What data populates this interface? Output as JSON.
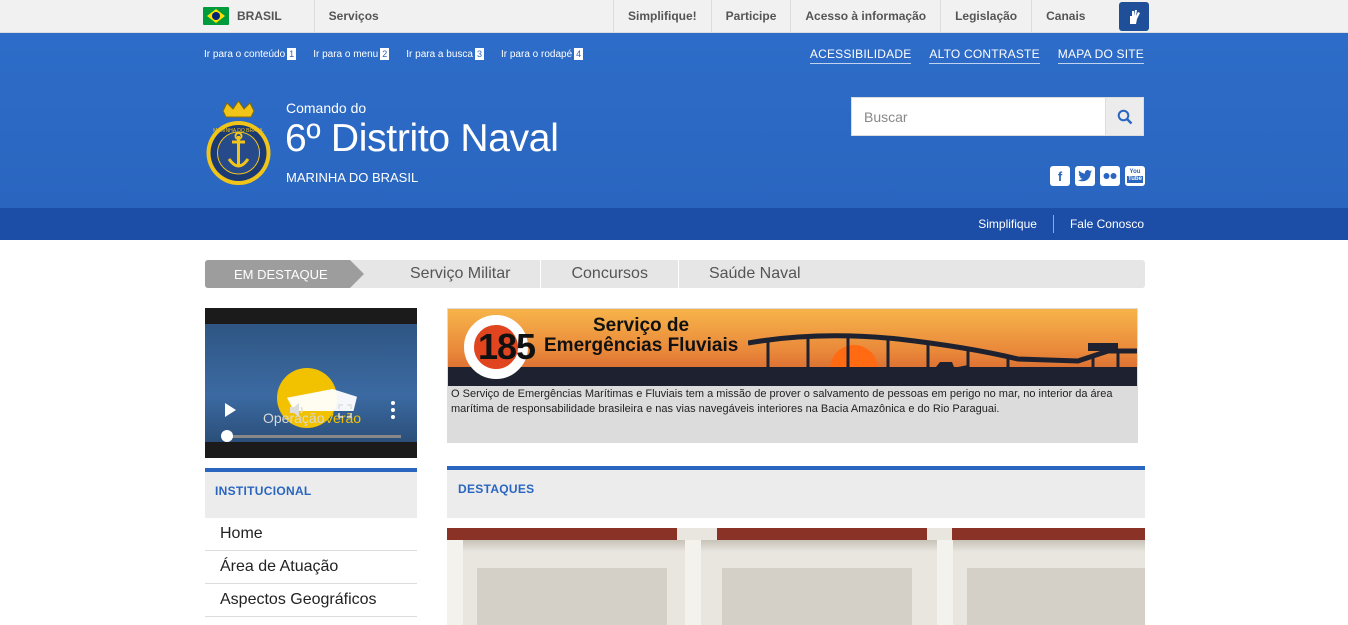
{
  "govbar": {
    "country": "BRASIL",
    "services": "Serviços",
    "links": [
      "Simplifique!",
      "Participe",
      "Acesso à informação",
      "Legislação",
      "Canais"
    ]
  },
  "header": {
    "skip_links": [
      {
        "label": "Ir para o conteúdo",
        "key": "1"
      },
      {
        "label": "Ir para o menu",
        "key": "2"
      },
      {
        "label": "Ir para a busca",
        "key": "3"
      },
      {
        "label": "Ir para o rodapé",
        "key": "4"
      }
    ],
    "top_links": [
      "ACESSIBILIDADE",
      "ALTO CONTRASTE",
      "MAPA DO SITE"
    ],
    "brand_sub": "Comando do",
    "brand_title": "6º Distrito Naval",
    "brand_org": "MARINHA DO BRASIL",
    "logo_text": "MARINHA DO BRASIL",
    "search_placeholder": "Buscar",
    "socials": [
      "facebook-icon",
      "twitter-icon",
      "flickr-icon",
      "youtube-icon"
    ]
  },
  "subbar": {
    "links": [
      "Simplifique",
      "Fale Conosco"
    ]
  },
  "tabs": {
    "active": "EM DESTAQUE",
    "items": [
      "Serviço Militar",
      "Concursos",
      "Saúde Naval"
    ]
  },
  "video": {
    "title_a": "Operação",
    "title_b": "Verão"
  },
  "sidebar": {
    "heading": "INSTITUCIONAL",
    "items": [
      "Home",
      "Área de Atuação",
      "Aspectos Geográficos"
    ]
  },
  "banner": {
    "number": "185",
    "line1": "Serviço de",
    "line2": "Emergências Fluviais",
    "description": "O Serviço de Emergências Marítimas e Fluviais tem a missão de prover o salvamento de pessoas em perigo no mar, no interior da área marítima de responsabilidade brasileira e nas vias navegáveis interiores na Bacia Amazônica e do Rio Paraguai."
  },
  "destaques": {
    "heading": "DESTAQUES"
  },
  "colors": {
    "primary": "#2a66c0",
    "subbar": "#1c4ea8",
    "govbar": "#f1f1f1"
  }
}
